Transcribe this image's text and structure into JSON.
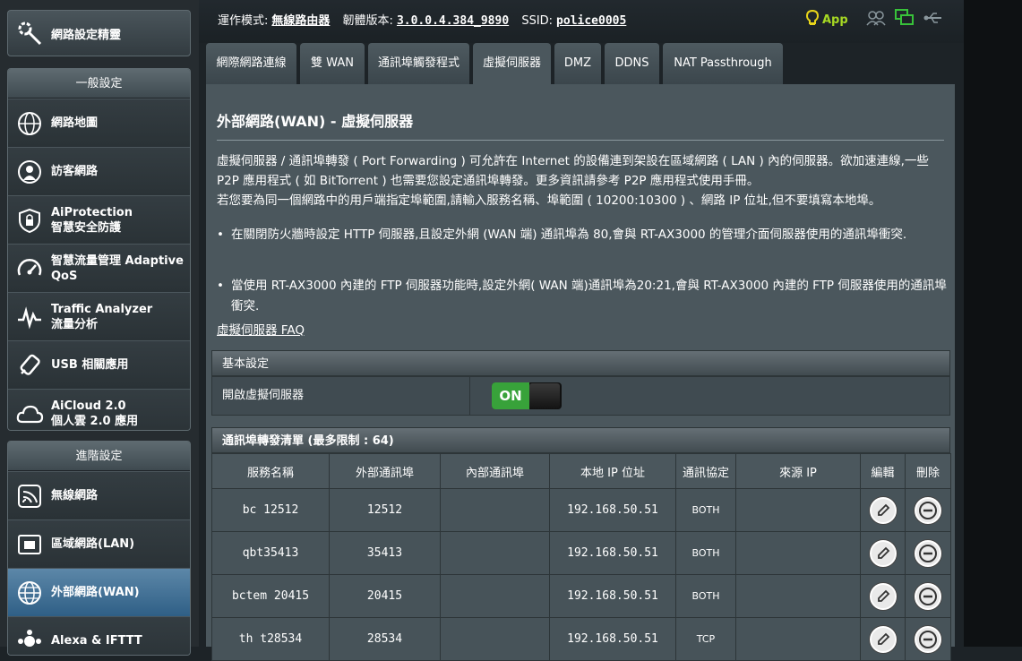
{
  "sidebar": {
    "quick_setup": "網路設定精靈",
    "general": {
      "header": "一般設定",
      "items": [
        {
          "label": "網路地圖",
          "sub": ""
        },
        {
          "label": "訪客網路",
          "sub": ""
        },
        {
          "label": "AiProtection",
          "sub": "智慧安全防護"
        },
        {
          "label": "智慧流量管理 Adaptive",
          "sub": "QoS"
        },
        {
          "label": "Traffic Analyzer",
          "sub": "流量分析"
        },
        {
          "label": "USB 相關應用",
          "sub": ""
        },
        {
          "label": "AiCloud 2.0",
          "sub": "個人雲 2.0 應用"
        }
      ]
    },
    "advanced": {
      "header": "進階設定",
      "items": [
        {
          "label": "無線網路"
        },
        {
          "label": "區域網路(LAN)"
        },
        {
          "label": "外部網路(WAN)"
        },
        {
          "label": "Alexa & IFTTT"
        }
      ]
    }
  },
  "status": {
    "mode_label": "運作模式:",
    "mode_value": "無線路由器",
    "fw_label": "韌體版本:",
    "fw_value": "3.0.0.4.384_9890",
    "ssid_label": "SSID:",
    "ssid_value": "police0005",
    "app_label": "App"
  },
  "tabs": [
    "網際網路連線",
    "雙 WAN",
    "通訊埠觸發程式",
    "虛擬伺服器",
    "DMZ",
    "DDNS",
    "NAT Passthrough"
  ],
  "page": {
    "title": "外部網路(WAN) - 虛擬伺服器",
    "desc1": "虛擬伺服器 / 通訊埠轉發 ( Port Forwarding ) 可允許在 Internet 的設備連到架設在區域網路 ( LAN ) 內的伺服器。欲加速連線,一些 P2P 應用程式 ( 如 BitTorrent ) 也需要您設定通訊埠轉發。更多資訊請參考 P2P 應用程式使用手冊。",
    "desc2": "若您要為同一個網路中的用戶端指定埠範圍,請輸入服務名稱、埠範圍 ( 10200:10300 ) 、網路 IP 位址,但不要填寫本地埠。",
    "bullet1": "在關閉防火牆時設定 HTTP 伺服器,且設定外網 (WAN 端) 通訊埠為 80,會與 RT-AX3000 的管理介面伺服器使用的通訊埠衝突.",
    "bullet2": "當使用 RT-AX3000 內建的 FTP 伺服器功能時,設定外網( WAN 端)通訊埠為20:21,會與 RT-AX3000 內建的 FTP 伺服器使用的通訊埠衝突.",
    "faq": "虛擬伺服器 FAQ"
  },
  "basic": {
    "header": "基本設定",
    "enable_label": "開啟虛擬伺服器",
    "toggle_state": "ON"
  },
  "forward_list": {
    "header": "通訊埠轉發清單 (最多限制 : 64)",
    "columns": [
      "服務名稱",
      "外部通訊埠",
      "內部通訊埠",
      "本地 IP 位址",
      "通訊協定",
      "來源 IP",
      "編輯",
      "刪除"
    ],
    "rows": [
      {
        "name": "bc 12512",
        "ext": "12512",
        "int": "",
        "ip": "192.168.50.51",
        "proto": "BOTH",
        "src": ""
      },
      {
        "name": "qbt35413",
        "ext": "35413",
        "int": "",
        "ip": "192.168.50.51",
        "proto": "BOTH",
        "src": ""
      },
      {
        "name": "bctem 20415",
        "ext": "20415",
        "int": "",
        "ip": "192.168.50.51",
        "proto": "BOTH",
        "src": ""
      },
      {
        "name": "th t28534",
        "ext": "28534",
        "int": "",
        "ip": "192.168.50.51",
        "proto": "TCP",
        "src": ""
      }
    ]
  },
  "colors": {
    "accent_green": "#38a23a",
    "app_green": "#a6d823",
    "active_menu": "#2f5f86"
  }
}
